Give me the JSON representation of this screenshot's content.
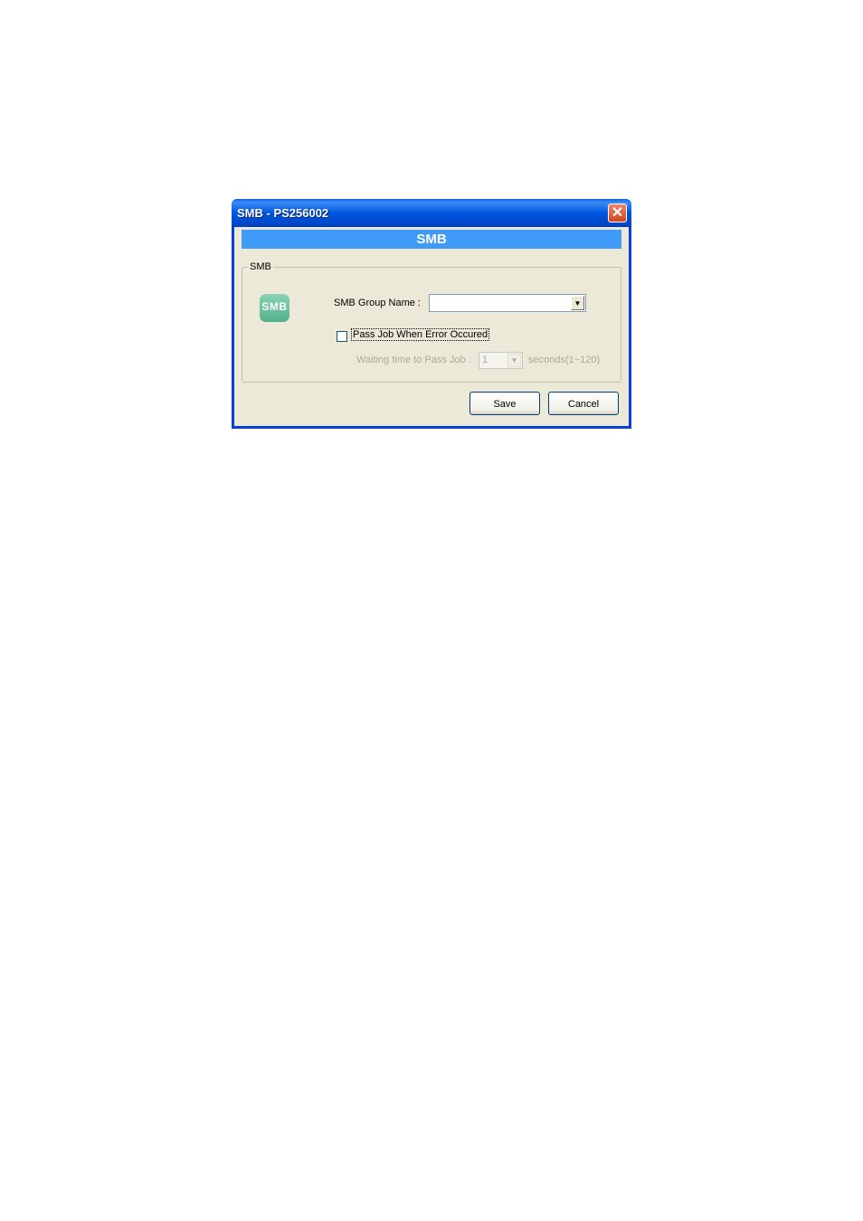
{
  "window": {
    "title": "SMB - PS256002",
    "close_symbol": "✕"
  },
  "banner": {
    "title": "SMB"
  },
  "group": {
    "legend": "SMB",
    "icon_text": "SMB",
    "group_name_label": "SMB Group Name :",
    "group_name_value": "",
    "pass_job_label": "Pass Job When Error Occured",
    "pass_job_checked": false,
    "waiting_label": "Waiting time to Pass Job :",
    "waiting_value": "1",
    "seconds_label": "seconds(1~120)"
  },
  "buttons": {
    "save": "Save",
    "cancel": "Cancel"
  },
  "icons": {
    "dropdown_arrow": "▼"
  }
}
